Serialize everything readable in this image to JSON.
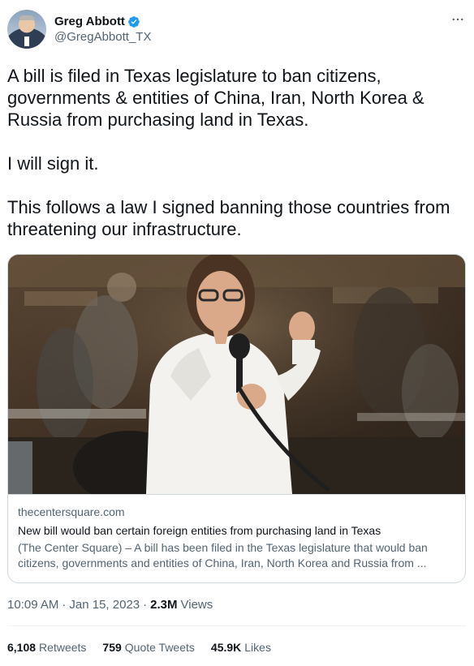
{
  "author": {
    "display_name": "Greg Abbott",
    "handle": "@GregAbbott_TX",
    "verified": true,
    "verified_color": "#1d9bf0"
  },
  "tweet": {
    "paragraphs": [
      "A bill is filed in Texas legislature to ban citizens, governments & entities of China, Iran, North Korea & Russia from purchasing land in Texas.",
      "I will sign it.",
      "This follows a law I signed banning those countries from threatening our infrastructure."
    ]
  },
  "link_card": {
    "domain": "thecentersquare.com",
    "title": "New bill would ban certain foreign entities from purchasing land in Texas",
    "description": "(The Center Square) – A bill has been filed in the Texas legislature that would ban citizens, governments and entities of China, Iran, North Korea and Russia from ..."
  },
  "meta": {
    "time": "10:09 AM",
    "separator": "·",
    "date": "Jan 15, 2023",
    "views_count": "2.3M",
    "views_label": "Views"
  },
  "stats": {
    "retweets_count": "6,108",
    "retweets_label": "Retweets",
    "quotes_count": "759",
    "quotes_label": "Quote Tweets",
    "likes_count": "45.9K",
    "likes_label": "Likes"
  },
  "icons": {
    "verified": "verified-badge-icon",
    "more": "more-horizontal-icon"
  }
}
